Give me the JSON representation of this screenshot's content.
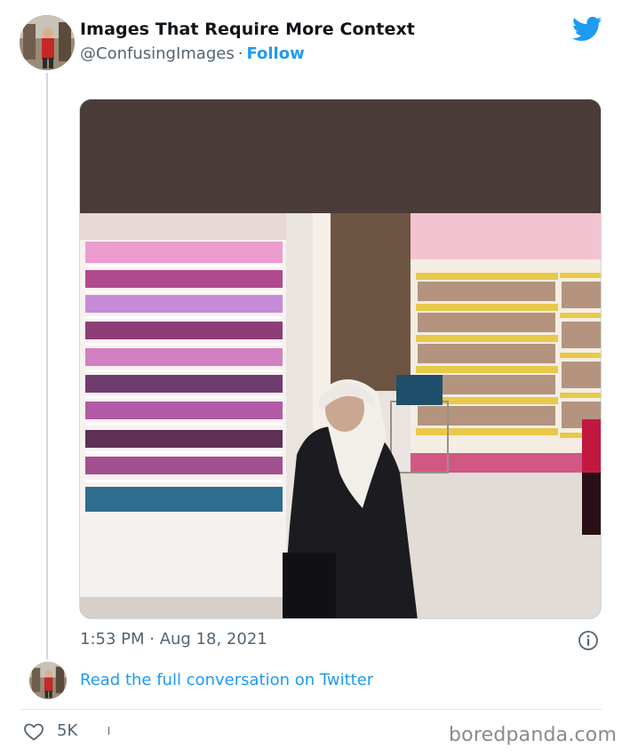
{
  "tweet": {
    "account_name": "Images That Require More Context",
    "handle": "@ConfusingImages",
    "separator": "·",
    "follow_label": "Follow",
    "timestamp": "1:53 PM · Aug 18, 2021",
    "read_conversation_label": "Read the full conversation on Twitter",
    "like_count": "5K"
  },
  "media": {
    "description_icon": "photo"
  },
  "watermark": {
    "text": "boredpanda.com"
  },
  "icons": {
    "brand": "twitter-bird-icon",
    "info": "info-icon",
    "like": "heart-icon"
  },
  "colors": {
    "twitter_blue": "#1d9bf0",
    "secondary_text": "#536471",
    "primary_text": "#0f1419"
  }
}
